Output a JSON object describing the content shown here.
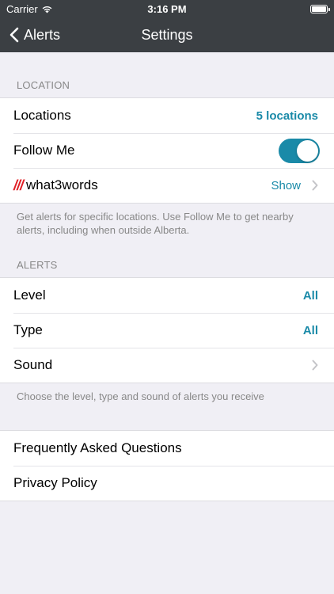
{
  "status": {
    "carrier": "Carrier",
    "time": "3:16 PM"
  },
  "nav": {
    "back_label": "Alerts",
    "title": "Settings"
  },
  "location_section": {
    "header": "LOCATION",
    "rows": {
      "locations": {
        "label": "Locations",
        "value": "5 locations"
      },
      "follow_me": {
        "label": "Follow Me",
        "on": true
      },
      "w3w": {
        "logo": "///",
        "label": "what3words",
        "value": "Show"
      }
    },
    "footer": "Get alerts for specific locations. Use Follow Me to get nearby alerts, including when outside Alberta."
  },
  "alerts_section": {
    "header": "ALERTS",
    "rows": {
      "level": {
        "label": "Level",
        "value": "All"
      },
      "type": {
        "label": "Type",
        "value": "All"
      },
      "sound": {
        "label": "Sound"
      }
    },
    "footer": "Choose the level, type and sound of alerts you receive"
  },
  "info_section": {
    "faq": "Frequently Asked Questions",
    "privacy": "Privacy Policy"
  },
  "colors": {
    "accent": "#1a8aa8",
    "nav_bg": "#3b3f43",
    "w3w_red": "#e11f26"
  }
}
